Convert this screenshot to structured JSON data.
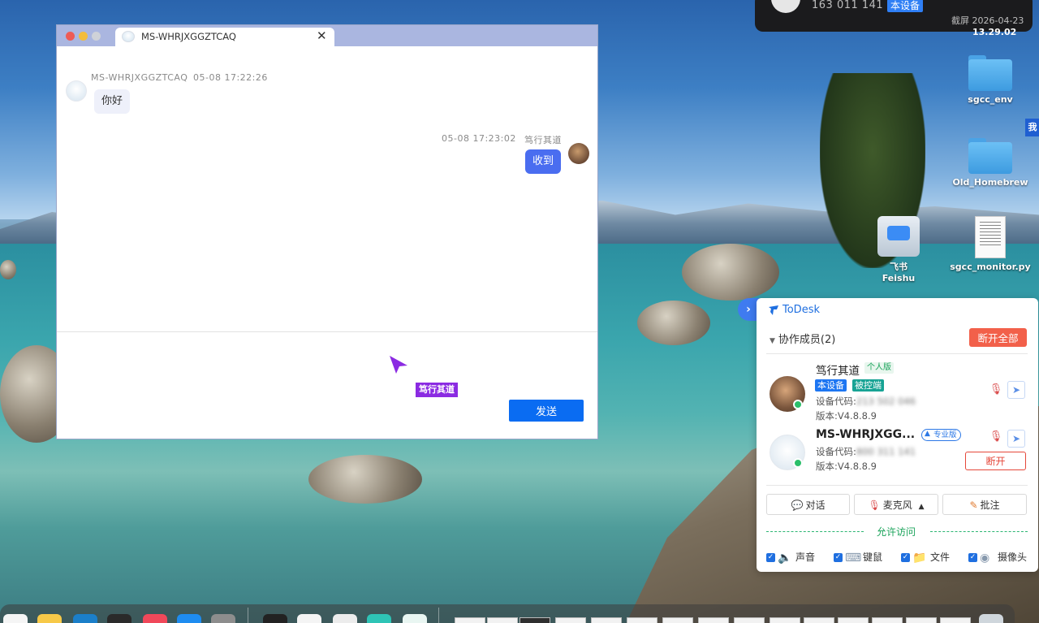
{
  "notification": {
    "number": "163 011 141",
    "tag": "本设备",
    "time_line1": "截屏 2026-04-23",
    "time_line2": "13.29.02"
  },
  "desktop": {
    "icons": [
      {
        "label": "sgcc_env"
      },
      {
        "label": "Old_Homebrew"
      },
      {
        "label": "飞书 Feishu"
      },
      {
        "label": "sgcc_monitor.py"
      }
    ],
    "side_tab": "我"
  },
  "chat_window": {
    "tab_title": "MS-WHRJXGGZTCAQ",
    "close_glyph": "✕",
    "messages": [
      {
        "sender": "MS-WHRJXGGZTCAQ",
        "time": "05-08 17:22:26",
        "text": "你好"
      },
      {
        "sender": "笃行其道",
        "time": "05-08 17:23:02",
        "text": "收到"
      }
    ],
    "send_label": "发送",
    "cursor_label": "笃行其道"
  },
  "todesk": {
    "title": "ToDesk",
    "collapse_glyph": "›",
    "members_label": "协作成员(2)",
    "disconnect_all": "断开全部",
    "members": [
      {
        "name": "笃行其道",
        "edition": "个人版",
        "tags": [
          "本设备",
          "被控端"
        ],
        "device_code_label": "设备代码:",
        "device_code": "213 502 046",
        "version": "版本:V4.8.8.9"
      },
      {
        "name": "MS-WHRJXGG...",
        "edition": "专业版",
        "device_code_label": "设备代码:",
        "device_code": "800 311 141",
        "version": "版本:V4.8.8.9",
        "disconnect": "断开"
      }
    ],
    "actions": [
      {
        "label": "对话",
        "icon": "chat-icon"
      },
      {
        "label": "麦克风",
        "icon": "mic-muted-icon",
        "caret": "▲"
      },
      {
        "label": "批注",
        "icon": "pen-icon"
      }
    ],
    "allow_label": "允许访问",
    "permissions": [
      {
        "label": "声音",
        "icon": "speaker-icon",
        "checked": true
      },
      {
        "label": "键鼠",
        "icon": "keyboard-icon",
        "checked": true
      },
      {
        "label": "文件",
        "icon": "folder-icon",
        "checked": true
      },
      {
        "label": "摄像头",
        "icon": "camera-icon",
        "checked": true
      }
    ]
  },
  "colors": {
    "accent_blue": "#0a6cf2",
    "danger_red": "#f2604a",
    "online_green": "#2bbf6a",
    "cursor_purple": "#8b2be2"
  }
}
